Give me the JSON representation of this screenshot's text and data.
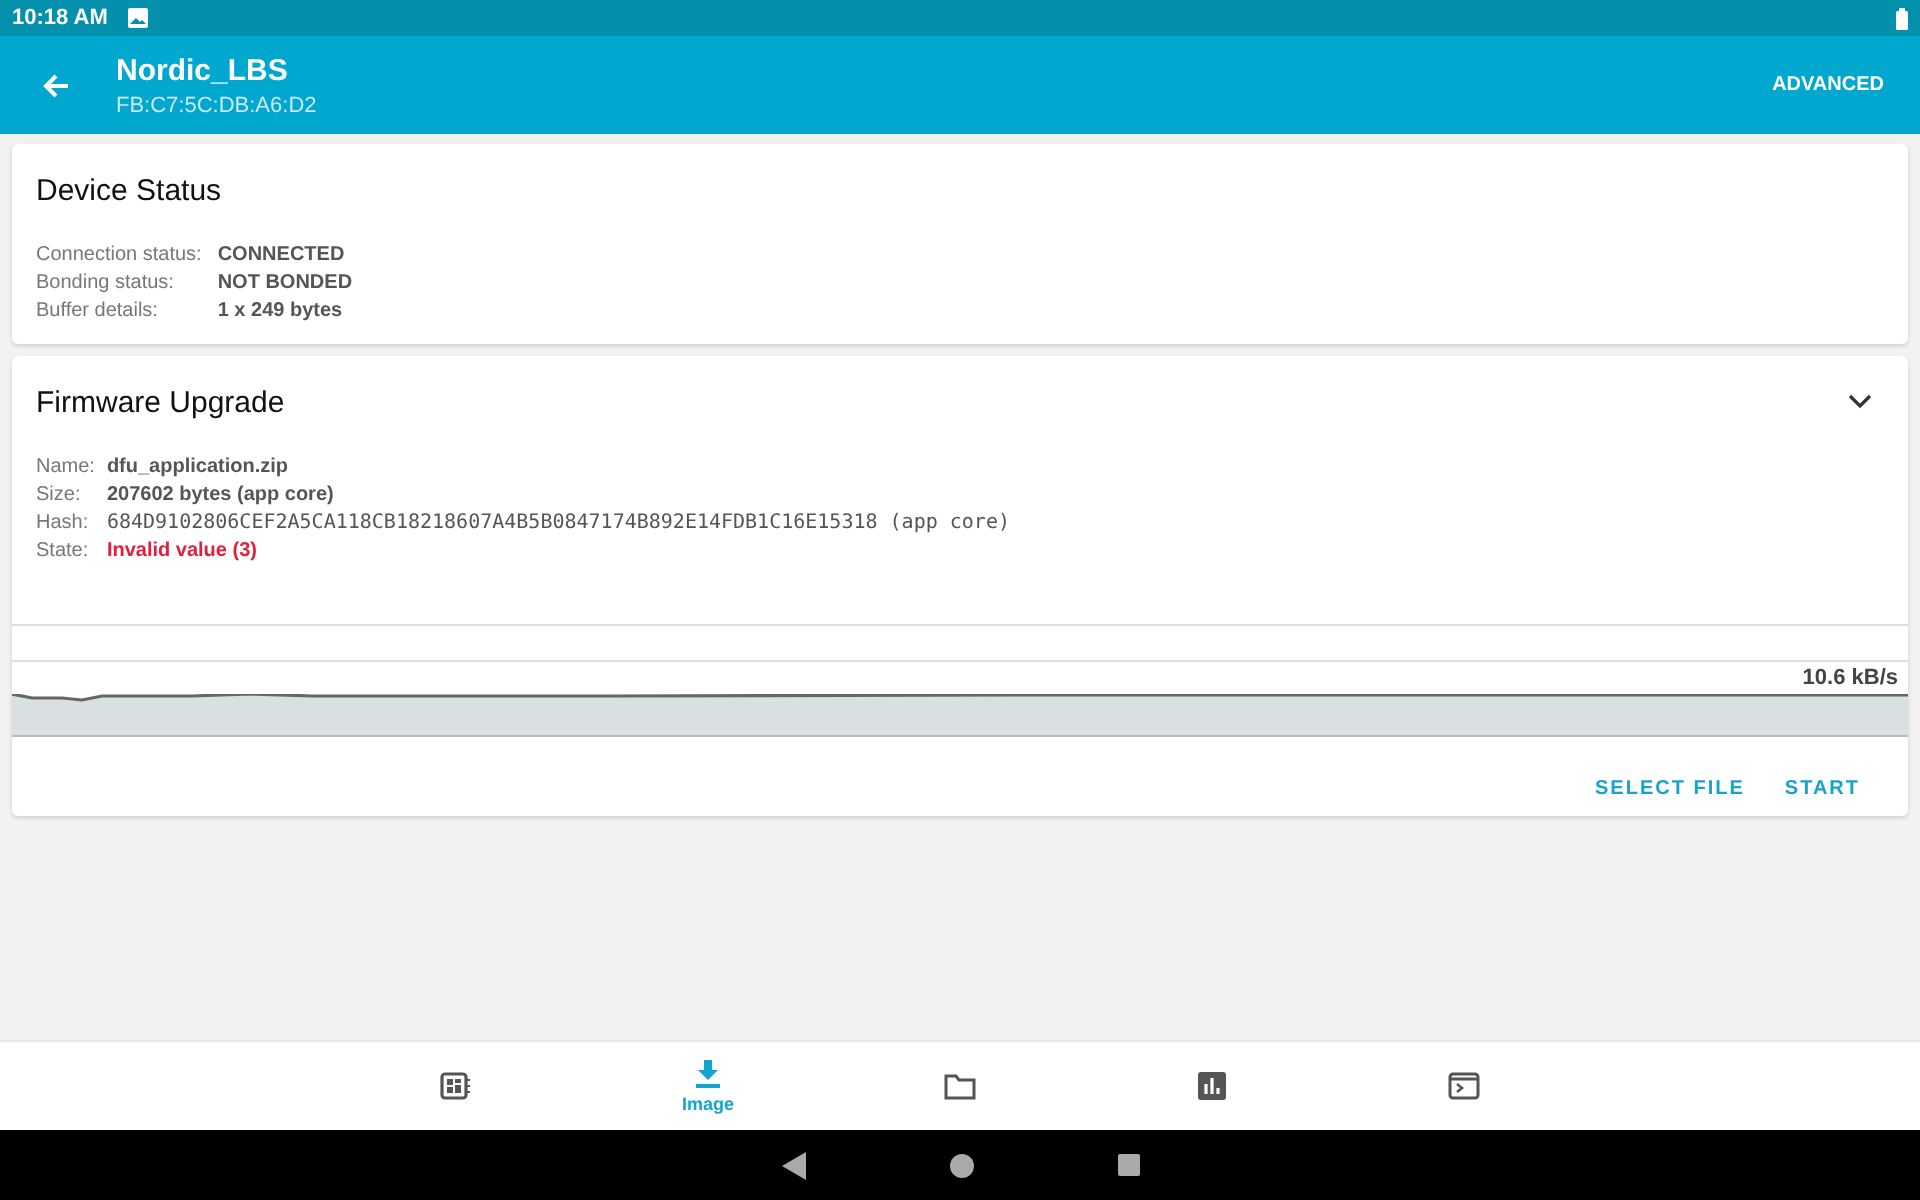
{
  "status_bar": {
    "time": "10:18 AM"
  },
  "app_bar": {
    "title": "Nordic_LBS",
    "subtitle": "FB:C7:5C:DB:A6:D2",
    "action": "ADVANCED"
  },
  "device_status": {
    "title": "Device Status",
    "rows": [
      {
        "label": "Connection status:",
        "value": "CONNECTED"
      },
      {
        "label": "Bonding status:",
        "value": "NOT BONDED"
      },
      {
        "label": "Buffer details:",
        "value": "1 x 249 bytes"
      }
    ]
  },
  "firmware_upgrade": {
    "title": "Firmware Upgrade",
    "expanded": true,
    "rows": [
      {
        "label": "Name:",
        "value": "dfu_application.zip",
        "kind": "normal"
      },
      {
        "label": "Size:",
        "value": "207602 bytes (app core)",
        "kind": "normal"
      },
      {
        "label": "Hash:",
        "value": "684D9102806CEF2A5CA118CB18218607A4B5B0847174B892E14FDB1C16E15318 (app core)",
        "kind": "mono"
      },
      {
        "label": "State:",
        "value": "Invalid value (3)",
        "kind": "error"
      }
    ],
    "speed": "10.6 kB/s",
    "buttons": [
      "SELECT FILE",
      "START"
    ]
  },
  "bottom_nav": [
    {
      "selected": false
    },
    {
      "label": "Image",
      "selected": true
    },
    {
      "selected": false
    },
    {
      "selected": false
    },
    {
      "selected": false
    }
  ]
}
